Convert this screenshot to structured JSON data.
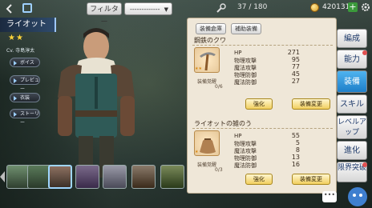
{
  "topbar": {
    "filter_label": "フィルター",
    "filter_value": "-------------",
    "unit_count": "37 / 180",
    "gold": "420131"
  },
  "hero": {
    "name": "ライオット",
    "stars": "★★",
    "cv": "Cv. 寺島淳太",
    "buttons": [
      "ボイス",
      "プレビュー",
      "衣装",
      "ストーリー"
    ]
  },
  "panel": {
    "tab_storage": "装備倉庫",
    "tab_auto": "補助装備",
    "items": [
      {
        "name": "鋼鉄のクワ",
        "awaken_label": "装備覚醒",
        "awaken_value": "0/6",
        "stars": "★★",
        "stats": [
          {
            "label": "HP",
            "value": "271"
          },
          {
            "label": "物理攻撃",
            "value": "95"
          },
          {
            "label": "魔法攻撃",
            "value": "77"
          },
          {
            "label": "物理防御",
            "value": "45"
          },
          {
            "label": "魔法防御",
            "value": "27"
          }
        ],
        "btn_upgrade": "強化",
        "btn_change": "装備変更"
      },
      {
        "name": "ライオットの雑のう",
        "awaken_label": "装備覚醒",
        "awaken_value": "0/3",
        "stars": "★",
        "stats": [
          {
            "label": "HP",
            "value": "55"
          },
          {
            "label": "物理攻撃",
            "value": "5"
          },
          {
            "label": "魔法攻撃",
            "value": "8"
          },
          {
            "label": "物理防御",
            "value": "13"
          },
          {
            "label": "魔法防御",
            "value": "16"
          }
        ],
        "btn_upgrade": "強化",
        "btn_change": "装備変更"
      }
    ]
  },
  "sidemenu": {
    "items": [
      "編成",
      "能力",
      "装備",
      "スキル",
      "レベルアップ",
      "進化",
      "限界突破"
    ]
  },
  "chat_label": "•••",
  "colors": {
    "accent_blue": "#1e7fc9",
    "panel_bg": "#efe7d8",
    "button_gold": "#f1cf5f"
  }
}
